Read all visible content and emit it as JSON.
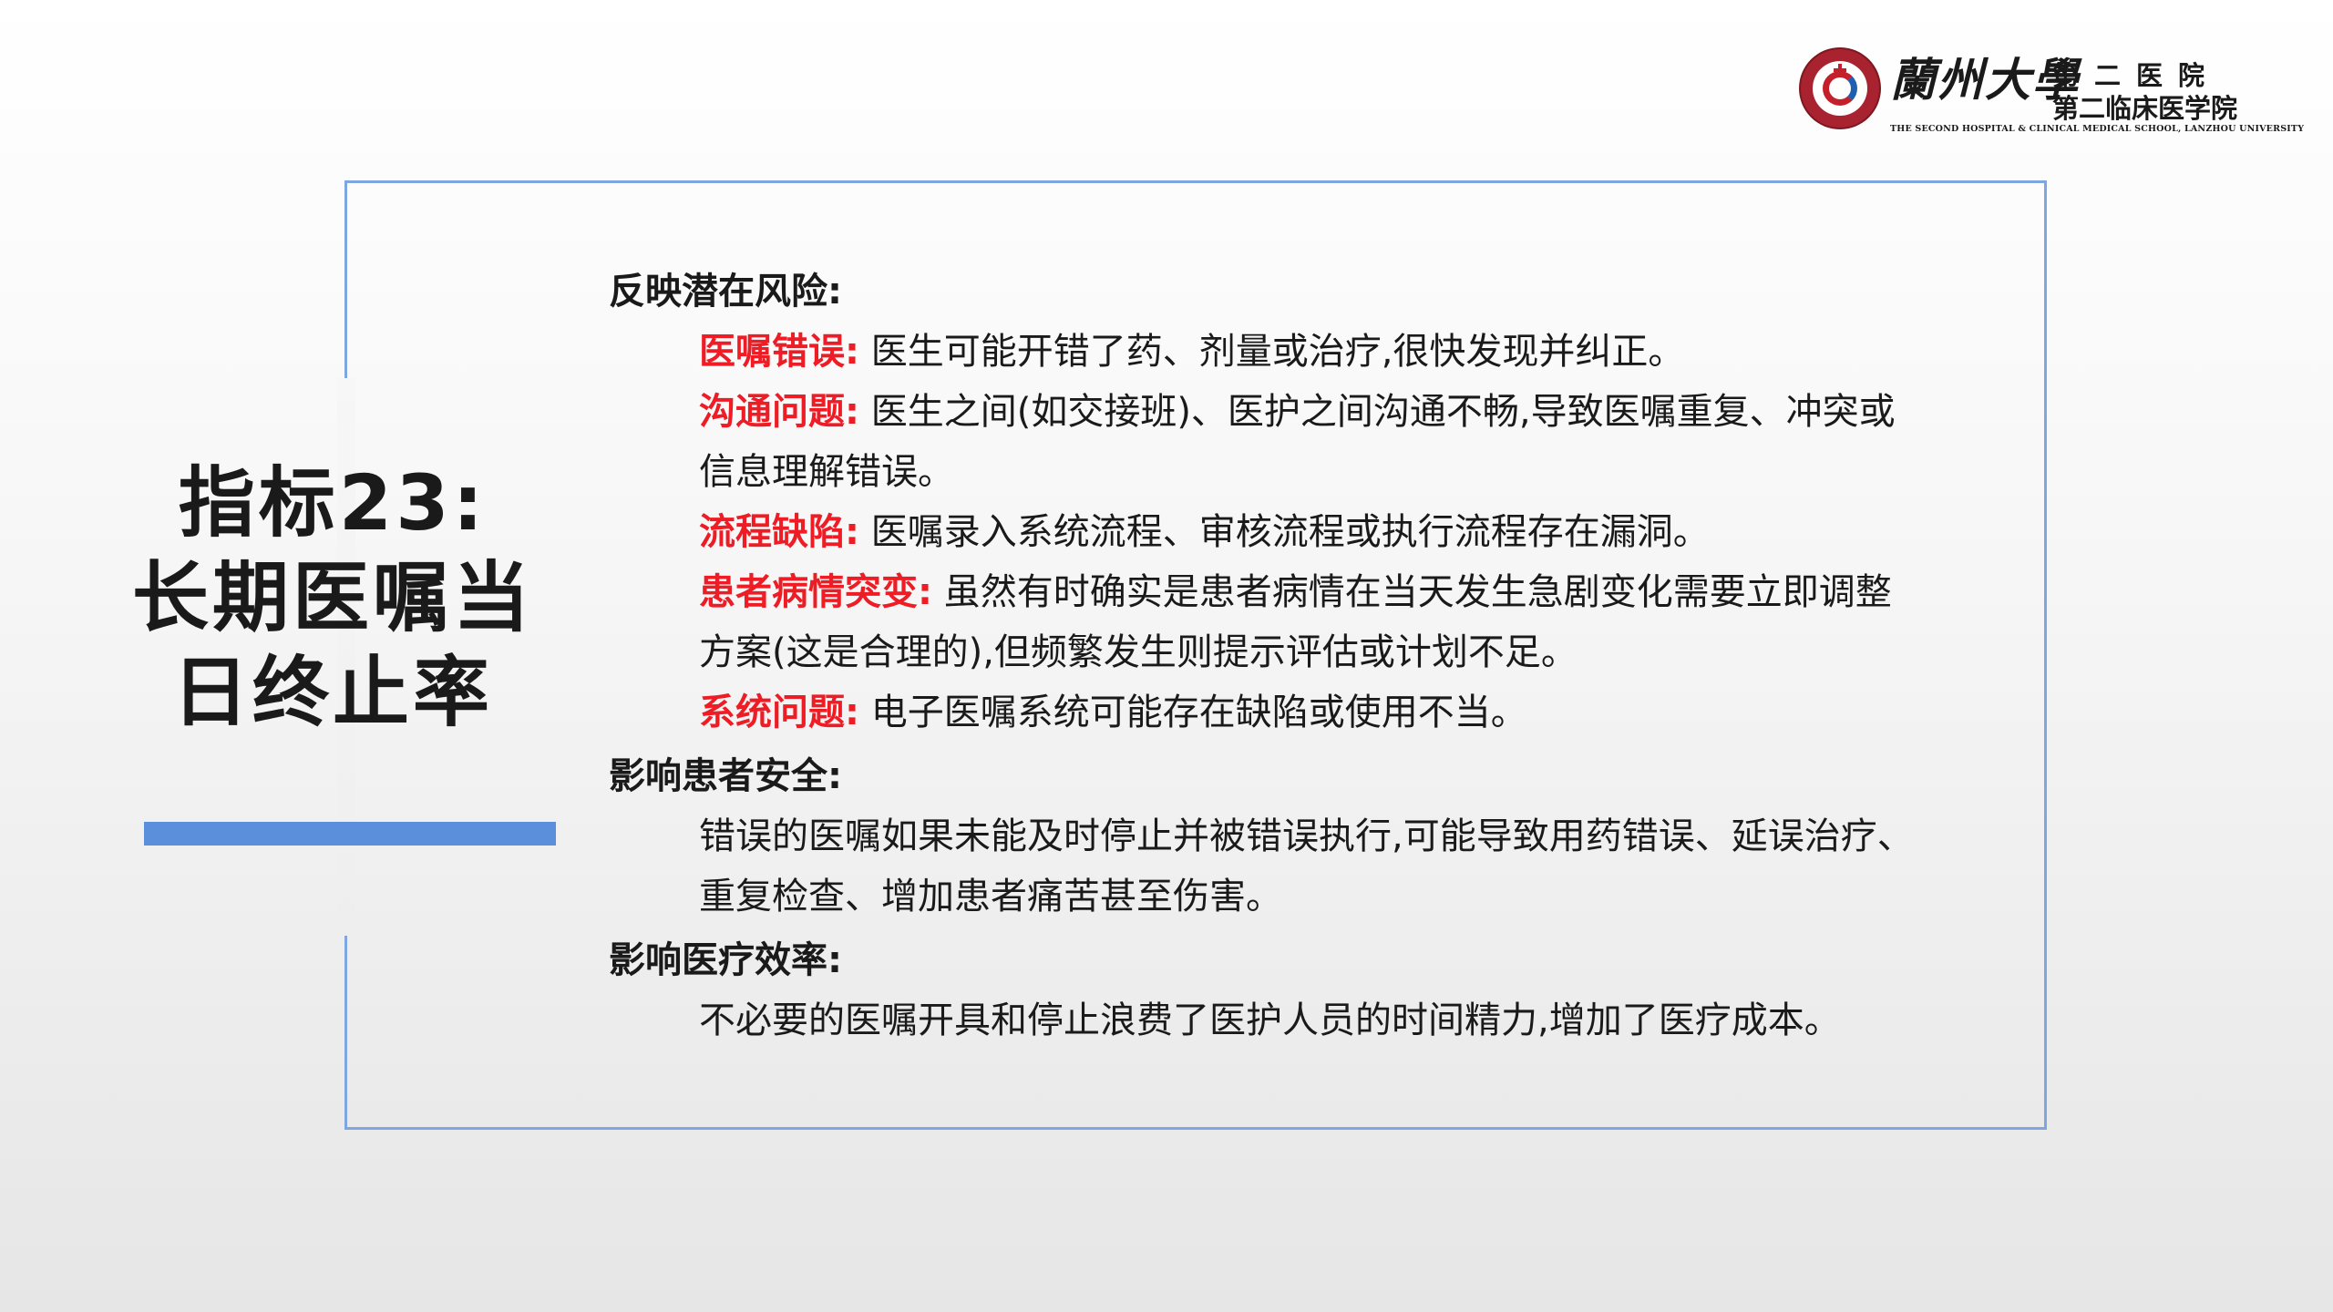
{
  "logo": {
    "calligraphy": "蘭州大學",
    "line1": "第二医院",
    "line2": "第二临床医学院",
    "english": "THE SECOND HOSPITAL & CLINICAL MEDICAL SCHOOL, LANZHOU UNIVERSITY"
  },
  "title": {
    "line1": "指标23:",
    "line2": "长期医嘱当",
    "line3": "日终止率"
  },
  "colors": {
    "accent_bar": "#5b8fdc",
    "frame_border": "#7ea6e0",
    "highlight_red": "#ee1c25"
  },
  "sections": [
    {
      "heading": "反映潜在风险:",
      "items": [
        {
          "label": "医嘱错误:",
          "text": " 医生可能开错了药、剂量或治疗,很快发现并纠正。"
        },
        {
          "label": "沟通问题:",
          "text": " 医生之间(如交接班)、医护之间沟通不畅,导致医嘱重复、冲突或",
          "cont": "信息理解错误。"
        },
        {
          "label": "流程缺陷:",
          "text": " 医嘱录入系统流程、审核流程或执行流程存在漏洞。"
        },
        {
          "label": "患者病情突变:",
          "text": " 虽然有时确实是患者病情在当天发生急剧变化需要立即调整",
          "cont": "方案(这是合理的),但频繁发生则提示评估或计划不足。"
        },
        {
          "label": "系统问题:",
          "text": " 电子医嘱系统可能存在缺陷或使用不当。"
        }
      ]
    },
    {
      "heading": "影响患者安全:",
      "lines": [
        "错误的医嘱如果未能及时停止并被错误执行,可能导致用药错误、延误治疗、",
        "重复检查、增加患者痛苦甚至伤害。"
      ]
    },
    {
      "heading": "影响医疗效率:",
      "lines": [
        "不必要的医嘱开具和停止浪费了医护人员的时间精力,增加了医疗成本。"
      ]
    }
  ]
}
